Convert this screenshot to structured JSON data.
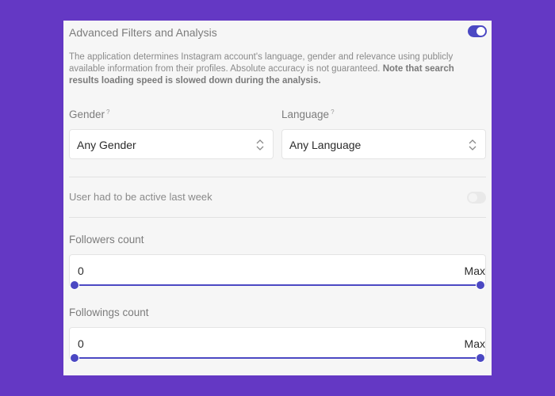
{
  "panel": {
    "title": "Advanced Filters and Analysis",
    "enabled": true,
    "description": "The application determines Instagram account's language, gender and relevance using publicly available information from their profiles. Absolute accuracy is not guaranteed.",
    "note": "Note that search results loading speed is slowed down during the analysis."
  },
  "gender": {
    "label": "Gender",
    "hint_mark": "?",
    "value": "Any Gender"
  },
  "language": {
    "label": "Language",
    "hint_mark": "?",
    "value": "Any Language"
  },
  "active_last_week": {
    "label": "User had to be active last week",
    "enabled": false
  },
  "followers": {
    "label": "Followers count",
    "min": "0",
    "max": "Max"
  },
  "followings": {
    "label": "Followings count",
    "min": "0",
    "max": "Max"
  },
  "colors": {
    "background": "#6438c4",
    "accent": "#4b48c3",
    "panel": "#f6f6f6"
  }
}
